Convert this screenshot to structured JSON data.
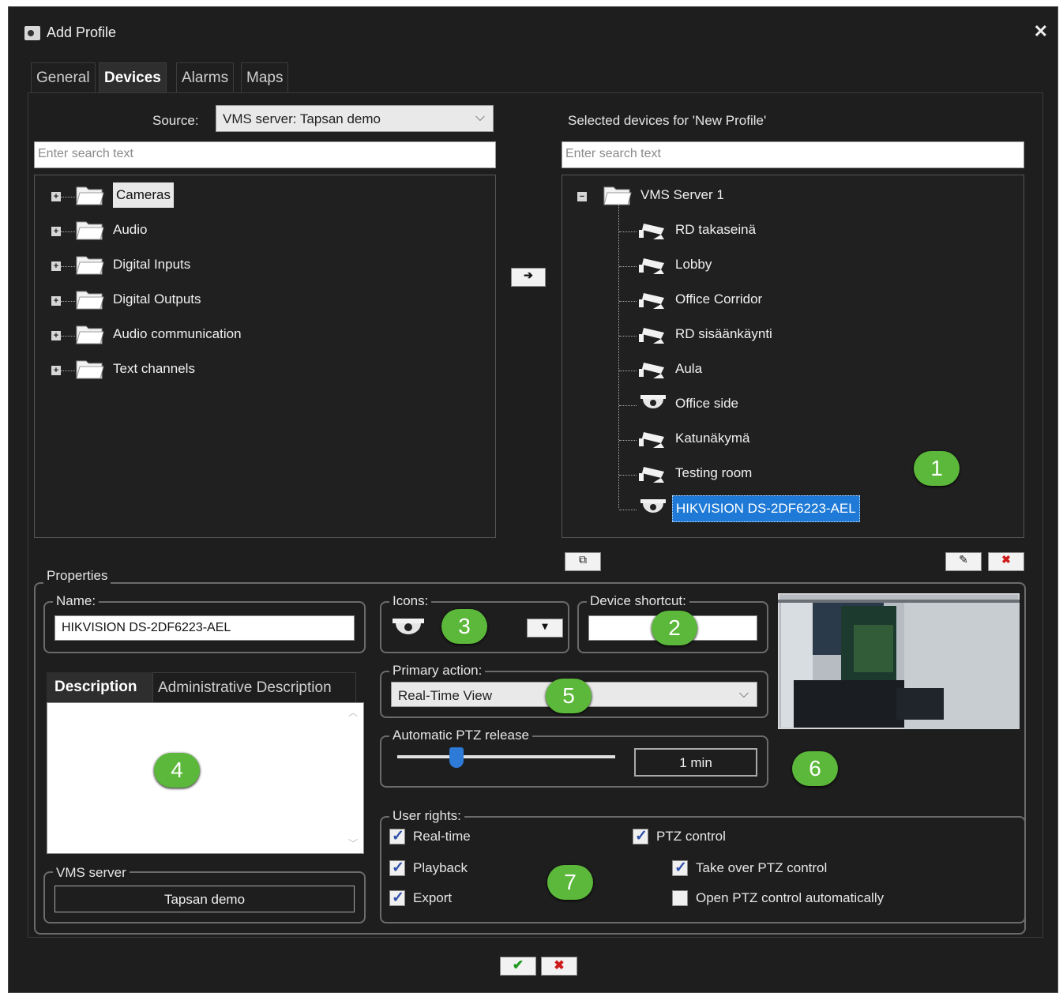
{
  "window": {
    "title": "Add Profile"
  },
  "tabs": [
    {
      "label": "General"
    },
    {
      "label": "Devices"
    },
    {
      "label": "Alarms"
    },
    {
      "label": "Maps"
    }
  ],
  "source": {
    "label": "Source:",
    "value": "VMS server: Tapsan demo"
  },
  "left_search": {
    "placeholder": "Enter search text"
  },
  "left_tree": [
    {
      "label": "Cameras"
    },
    {
      "label": "Audio"
    },
    {
      "label": "Digital Inputs"
    },
    {
      "label": "Digital Outputs"
    },
    {
      "label": "Audio communication"
    },
    {
      "label": "Text channels"
    }
  ],
  "right_header": "Selected devices for 'New Profile'",
  "right_search": {
    "placeholder": "Enter search text"
  },
  "right_tree": {
    "root": "VMS Server 1",
    "items": [
      {
        "label": "RD takaseinä",
        "icon": "bullet-camera-icon"
      },
      {
        "label": "Lobby",
        "icon": "bullet-camera-icon"
      },
      {
        "label": "Office Corridor",
        "icon": "bullet-camera-icon"
      },
      {
        "label": "RD sisäänkäynti",
        "icon": "bullet-camera-icon"
      },
      {
        "label": "Aula",
        "icon": "bullet-camera-icon"
      },
      {
        "label": "Office side",
        "icon": "dome-camera-icon"
      },
      {
        "label": "Katunäkymä",
        "icon": "bullet-camera-icon"
      },
      {
        "label": "Testing room",
        "icon": "bullet-camera-icon"
      },
      {
        "label": "HIKVISION DS-2DF6223-AEL",
        "icon": "dome-camera-icon",
        "selected": true
      }
    ]
  },
  "properties": {
    "title": "Properties",
    "name": {
      "label": "Name:",
      "value": "HIKVISION DS-2DF6223-AEL"
    },
    "icons": {
      "label": "Icons:"
    },
    "device_shortcut": {
      "label": "Device shortcut:",
      "value": ""
    },
    "description_tabs": [
      {
        "label": "Description"
      },
      {
        "label": "Administrative Description"
      }
    ],
    "primary_action": {
      "label": "Primary action:",
      "value": "Real-Time View"
    },
    "ptz_release": {
      "label": "Automatic PTZ release",
      "value": "1 min",
      "slider_fraction": 0.27
    },
    "vms_server": {
      "label": "VMS server",
      "value": "Tapsan demo"
    },
    "user_rights": {
      "label": "User rights:",
      "items": [
        {
          "label": "Real-time",
          "checked": true
        },
        {
          "label": "Playback",
          "checked": true
        },
        {
          "label": "Export",
          "checked": true
        },
        {
          "label": "PTZ control",
          "checked": true
        },
        {
          "label": "Take over PTZ control",
          "checked": true
        },
        {
          "label": "Open PTZ control automatically",
          "checked": false
        }
      ]
    }
  },
  "badges": [
    "1",
    "2",
    "3",
    "4",
    "5",
    "6",
    "7"
  ],
  "colors": {
    "badge": "#5cb83a",
    "selection": "#1e7ad6",
    "ok": "#1f9a1f",
    "cancel": "#d01a1a"
  }
}
